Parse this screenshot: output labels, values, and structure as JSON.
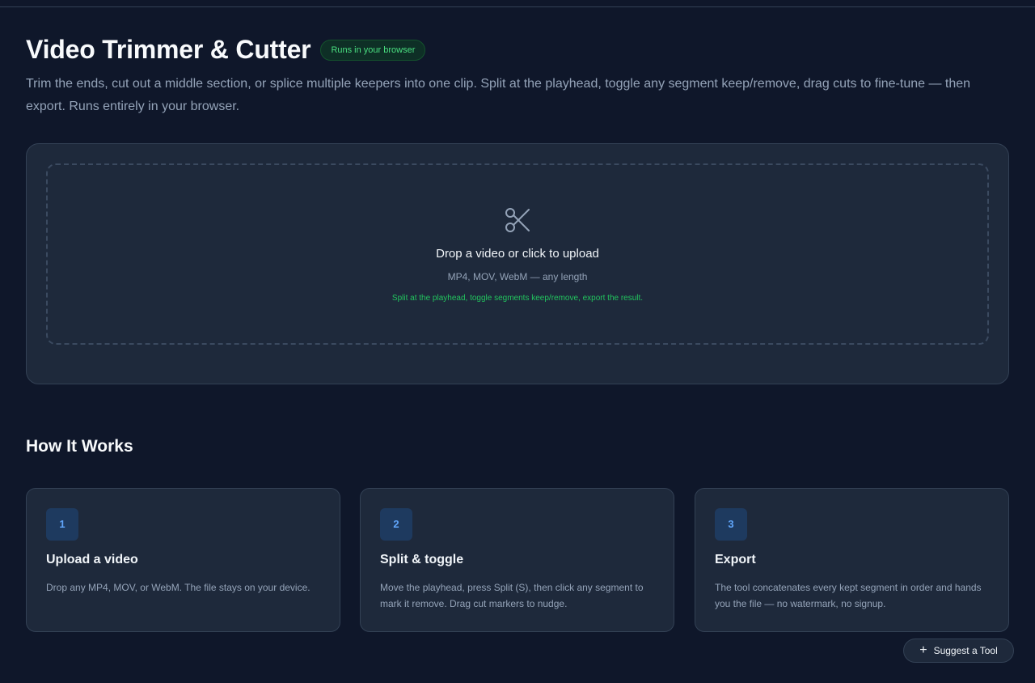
{
  "header": {
    "title": "Video Trimmer & Cutter",
    "badge": "Runs in your browser",
    "subtitle": "Trim the ends, cut out a middle section, or splice multiple keepers into one clip. Split at the playhead, toggle any segment keep/remove, drag cuts to fine-tune — then export. Runs entirely in your browser."
  },
  "upload": {
    "icon": "scissors-icon",
    "title": "Drop a video or click to upload",
    "formats": "MP4, MOV, WebM — any length",
    "hint": "Split at the playhead, toggle segments keep/remove, export the result."
  },
  "how_it_works": {
    "title": "How It Works",
    "steps": [
      {
        "number": "1",
        "title": "Upload a video",
        "description": "Drop any MP4, MOV, or WebM. The file stays on your device."
      },
      {
        "number": "2",
        "title": "Split & toggle",
        "description": "Move the playhead, press Split (S), then click any segment to mark it remove. Drag cut markers to nudge."
      },
      {
        "number": "3",
        "title": "Export",
        "description": "The tool concatenates every kept segment in order and hands you the file — no watermark, no signup."
      }
    ]
  },
  "suggest": {
    "label": "Suggest a Tool",
    "icon": "plus-icon"
  },
  "colors": {
    "background": "#0f172a",
    "card": "#1e293b",
    "accent_green": "#22c55e",
    "accent_blue": "#60a5fa"
  }
}
